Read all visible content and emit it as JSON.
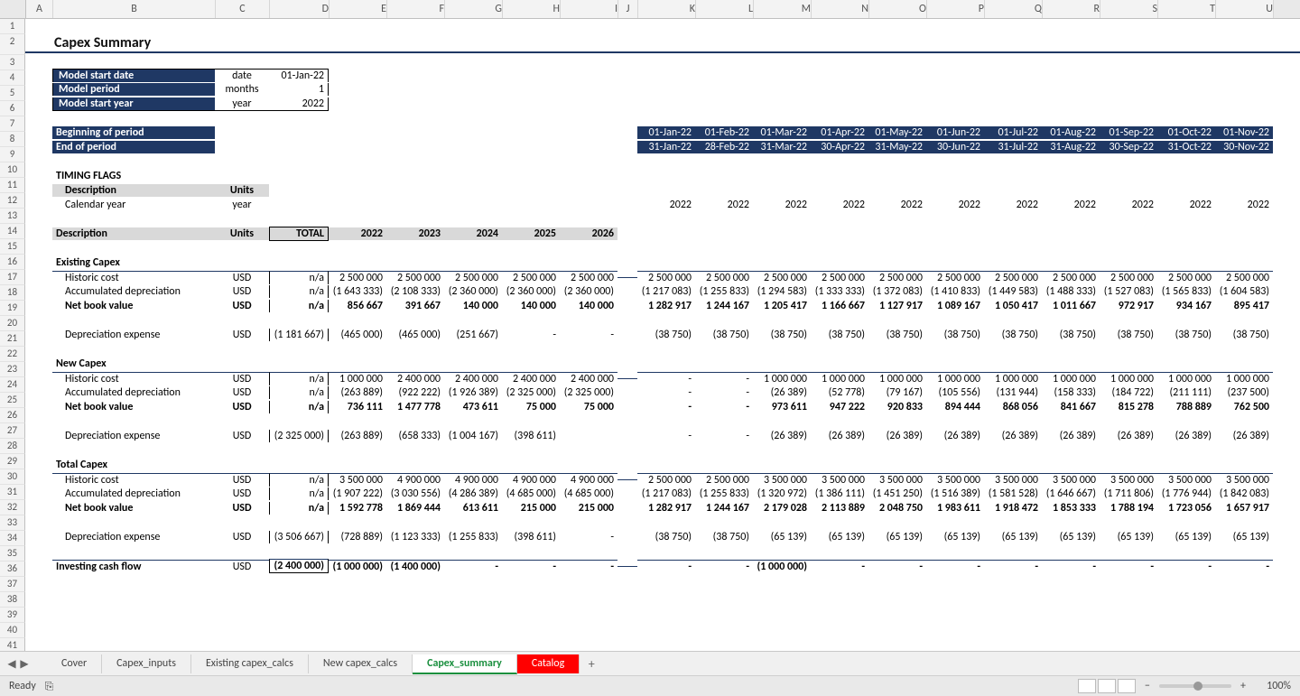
{
  "status": {
    "ready": "Ready",
    "zoom": "100%"
  },
  "tabs": {
    "items": [
      "Cover",
      "Capex_inputs",
      "Existing capex_calcs",
      "New capex_calcs",
      "Capex_summary",
      "Catalog"
    ],
    "active": "Capex_summary",
    "red": "Catalog"
  },
  "columns_visible": [
    "A",
    "B",
    "C",
    "D",
    "E",
    "F",
    "G",
    "H",
    "I",
    "J",
    "K",
    "L",
    "M",
    "N",
    "O",
    "P",
    "Q",
    "R",
    "S",
    "T",
    "U"
  ],
  "title": "Capex Summary",
  "settings": {
    "rows": [
      {
        "label": "Model start date",
        "unit": "date",
        "value": "01-Jan-22"
      },
      {
        "label": "Model period",
        "unit": "months",
        "value": "1"
      },
      {
        "label": "Model start year",
        "unit": "year",
        "value": "2022"
      }
    ]
  },
  "period_header": {
    "begin_label": "Beginning of period",
    "end_label": "End of period",
    "begin": [
      "01-Jan-22",
      "01-Feb-22",
      "01-Mar-22",
      "01-Apr-22",
      "01-May-22",
      "01-Jun-22",
      "01-Jul-22",
      "01-Aug-22",
      "01-Sep-22",
      "01-Oct-22",
      "01-Nov-22"
    ],
    "end": [
      "31-Jan-22",
      "28-Feb-22",
      "31-Mar-22",
      "30-Apr-22",
      "31-May-22",
      "30-Jun-22",
      "31-Jul-22",
      "31-Aug-22",
      "30-Sep-22",
      "31-Oct-22",
      "30-Nov-22"
    ]
  },
  "timing": {
    "section": "TIMING FLAGS",
    "desc_hdr": "Description",
    "units_hdr": "Units",
    "row": {
      "label": "Calendar year",
      "unit": "year"
    },
    "years": [
      "2022",
      "2022",
      "2022",
      "2022",
      "2022",
      "2022",
      "2022",
      "2022",
      "2022",
      "2022",
      "2022"
    ]
  },
  "annual_header": {
    "desc": "Description",
    "units": "Units",
    "total": "TOTAL",
    "years": [
      "2022",
      "2023",
      "2024",
      "2025",
      "2026"
    ]
  },
  "sections": {
    "existing": {
      "title": "Existing Capex",
      "rows": [
        {
          "label": "Historic cost",
          "unit": "USD",
          "total": "n/a",
          "annual": [
            "2 500 000",
            "2 500 000",
            "2 500 000",
            "2 500 000",
            "2 500 000"
          ],
          "monthly": [
            "2 500 000",
            "2 500 000",
            "2 500 000",
            "2 500 000",
            "2 500 000",
            "2 500 000",
            "2 500 000",
            "2 500 000",
            "2 500 000",
            "2 500 000",
            "2 500 000"
          ]
        },
        {
          "label": "Accumulated depreciation",
          "unit": "USD",
          "total": "n/a",
          "annual": [
            "(1 643 333)",
            "(2 108 333)",
            "(2 360 000)",
            "(2 360 000)",
            "(2 360 000)"
          ],
          "monthly": [
            "(1 217 083)",
            "(1 255 833)",
            "(1 294 583)",
            "(1 333 333)",
            "(1 372 083)",
            "(1 410 833)",
            "(1 449 583)",
            "(1 488 333)",
            "(1 527 083)",
            "(1 565 833)",
            "(1 604 583)"
          ]
        },
        {
          "label": "Net book value",
          "unit": "USD",
          "total": "n/a",
          "bold": true,
          "annual": [
            "856 667",
            "391 667",
            "140 000",
            "140 000",
            "140 000"
          ],
          "monthly": [
            "1 282 917",
            "1 244 167",
            "1 205 417",
            "1 166 667",
            "1 127 917",
            "1 089 167",
            "1 050 417",
            "1 011 667",
            "972 917",
            "934 167",
            "895 417"
          ]
        },
        {
          "blank": true
        },
        {
          "label": "Depreciation expense",
          "unit": "USD",
          "total": "(1 181 667)",
          "annual": [
            "(465 000)",
            "(465 000)",
            "(251 667)",
            "-",
            "-"
          ],
          "monthly": [
            "(38 750)",
            "(38 750)",
            "(38 750)",
            "(38 750)",
            "(38 750)",
            "(38 750)",
            "(38 750)",
            "(38 750)",
            "(38 750)",
            "(38 750)",
            "(38 750)"
          ]
        }
      ]
    },
    "new": {
      "title": "New Capex",
      "rows": [
        {
          "label": "Historic cost",
          "unit": "USD",
          "total": "n/a",
          "annual": [
            "1 000 000",
            "2 400 000",
            "2 400 000",
            "2 400 000",
            "2 400 000"
          ],
          "monthly": [
            "-",
            "-",
            "1 000 000",
            "1 000 000",
            "1 000 000",
            "1 000 000",
            "1 000 000",
            "1 000 000",
            "1 000 000",
            "1 000 000",
            "1 000 000"
          ]
        },
        {
          "label": "Accumulated depreciation",
          "unit": "USD",
          "total": "n/a",
          "annual": [
            "(263 889)",
            "(922 222)",
            "(1 926 389)",
            "(2 325 000)",
            "(2 325 000)"
          ],
          "monthly": [
            "-",
            "-",
            "(26 389)",
            "(52 778)",
            "(79 167)",
            "(105 556)",
            "(131 944)",
            "(158 333)",
            "(184 722)",
            "(211 111)",
            "(237 500)"
          ]
        },
        {
          "label": "Net book value",
          "unit": "USD",
          "total": "n/a",
          "bold": true,
          "annual": [
            "736 111",
            "1 477 778",
            "473 611",
            "75 000",
            "75 000"
          ],
          "monthly": [
            "-",
            "-",
            "973 611",
            "947 222",
            "920 833",
            "894 444",
            "868 056",
            "841 667",
            "815 278",
            "788 889",
            "762 500"
          ]
        },
        {
          "blank": true
        },
        {
          "label": "Depreciation expense",
          "unit": "USD",
          "total": "(2 325 000)",
          "annual": [
            "(263 889)",
            "(658 333)",
            "(1 004 167)",
            "(398 611)",
            ""
          ],
          "monthly": [
            "-",
            "-",
            "(26 389)",
            "(26 389)",
            "(26 389)",
            "(26 389)",
            "(26 389)",
            "(26 389)",
            "(26 389)",
            "(26 389)",
            "(26 389)"
          ]
        }
      ]
    },
    "total": {
      "title": "Total Capex",
      "rows": [
        {
          "label": "Historic cost",
          "unit": "USD",
          "total": "n/a",
          "annual": [
            "3 500 000",
            "4 900 000",
            "4 900 000",
            "4 900 000",
            "4 900 000"
          ],
          "monthly": [
            "2 500 000",
            "2 500 000",
            "3 500 000",
            "3 500 000",
            "3 500 000",
            "3 500 000",
            "3 500 000",
            "3 500 000",
            "3 500 000",
            "3 500 000",
            "3 500 000"
          ]
        },
        {
          "label": "Accumulated depreciation",
          "unit": "USD",
          "total": "n/a",
          "annual": [
            "(1 907 222)",
            "(3 030 556)",
            "(4 286 389)",
            "(4 685 000)",
            "(4 685 000)"
          ],
          "monthly": [
            "(1 217 083)",
            "(1 255 833)",
            "(1 320 972)",
            "(1 386 111)",
            "(1 451 250)",
            "(1 516 389)",
            "(1 581 528)",
            "(1 646 667)",
            "(1 711 806)",
            "(1 776 944)",
            "(1 842 083)"
          ]
        },
        {
          "label": "Net book value",
          "unit": "USD",
          "total": "n/a",
          "bold": true,
          "annual": [
            "1 592 778",
            "1 869 444",
            "613 611",
            "215 000",
            "215 000"
          ],
          "monthly": [
            "1 282 917",
            "1 244 167",
            "2 179 028",
            "2 113 889",
            "2 048 750",
            "1 983 611",
            "1 918 472",
            "1 853 333",
            "1 788 194",
            "1 723 056",
            "1 657 917"
          ]
        },
        {
          "blank": true
        },
        {
          "label": "Depreciation expense",
          "unit": "USD",
          "total": "(3 506 667)",
          "annual": [
            "(728 889)",
            "(1 123 333)",
            "(1 255 833)",
            "(398 611)",
            "-"
          ],
          "monthly": [
            "(38 750)",
            "(38 750)",
            "(65 139)",
            "(65 139)",
            "(65 139)",
            "(65 139)",
            "(65 139)",
            "(65 139)",
            "(65 139)",
            "(65 139)",
            "(65 139)"
          ]
        }
      ]
    }
  },
  "investing": {
    "label": "Investing cash flow",
    "unit": "USD",
    "total": "(2 400 000)",
    "annual": [
      "(1 000 000)",
      "(1 400 000)",
      "-",
      "-",
      "-"
    ],
    "monthly": [
      "-",
      "-",
      "(1 000 000)",
      "-",
      "-",
      "-",
      "-",
      "-",
      "-",
      "-",
      "-"
    ]
  }
}
